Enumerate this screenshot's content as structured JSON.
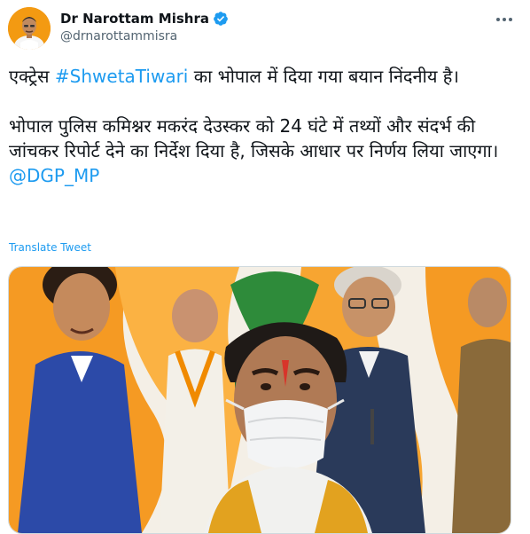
{
  "author": {
    "display_name": "Dr Narottam Mishra",
    "handle": "@drnarottammisra",
    "avatar_icon": "profile-photo",
    "verified_icon": "verified-badge-icon"
  },
  "tweet": {
    "line1_pre": "एक्ट्रेस ",
    "hashtag": "#ShwetaTiwari",
    "line1_post": " का भोपाल में दिया गया बयान निंदनीय है।",
    "paragraph2": "भोपाल पुलिस कमिश्नर मकरंद देउस्कर को 24 घंटे में तथ्यों और संदर्भ की जांचकर रिपोर्ट देने का निर्देश दिया है, जिसके आधार पर निर्णय लिया जाएगा।",
    "mention": "@DGP_MP",
    "translate_label": "Translate Tweet"
  },
  "colors": {
    "link": "#1d9bf0",
    "text": "#0f1419",
    "secondary": "#536471",
    "accent_orange": "#f08a00"
  }
}
